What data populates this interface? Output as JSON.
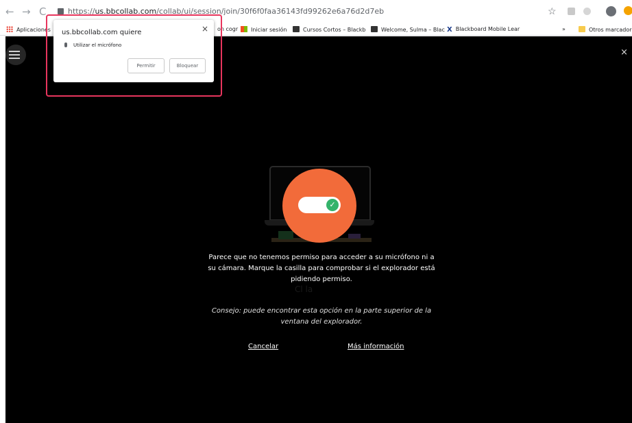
{
  "browser": {
    "url_prefix": "https://",
    "url_host": "us.bbcollab.com",
    "url_path": "/collab/ui/session/join/30f6f0faa36143fd99262e6a76d2d7eb",
    "back_icon": "arrow-left-icon",
    "forward_icon": "arrow-right-icon",
    "reload_icon": "reload-icon",
    "star_icon": "star-icon",
    "star_glyph": "☆"
  },
  "bookmarks": {
    "apps_label": "Aplicaciones",
    "item_partial": "on cogr",
    "login_label": "Iniciar sesión",
    "short_courses_label": "Cursos Cortos – Blackb",
    "welcome_label": "Welcome, Sulma – Blac",
    "mobile_label": "Blackboard Mobile Lear",
    "more_glyph": "»",
    "other_label": "Otros marcadores"
  },
  "app": {
    "close_glyph": "×",
    "check_glyph": "✓",
    "ghost_title": "Cl          la",
    "ghost_sub": "                                     ",
    "message": "Parece que no tenemos permiso para acceder a su micrófono ni a su cámara. Marque la casilla para comprobar si el explorador está pidiendo permiso.",
    "tip": "Consejo: puede encontrar esta opción en la parte superior de la ventana del explorador.",
    "cancel_label": "Cancelar",
    "more_info_label": "Más información"
  },
  "permission_popup": {
    "title": "us.bbcollab.com quiere",
    "close_glyph": "×",
    "request": "Utilizar el micrófono",
    "allow_label": "Permitir",
    "block_label": "Bloquear"
  },
  "colors": {
    "accent_orange": "#f26b3a",
    "toggle_green": "#34b36b",
    "highlight_pink": "#e8355d"
  }
}
